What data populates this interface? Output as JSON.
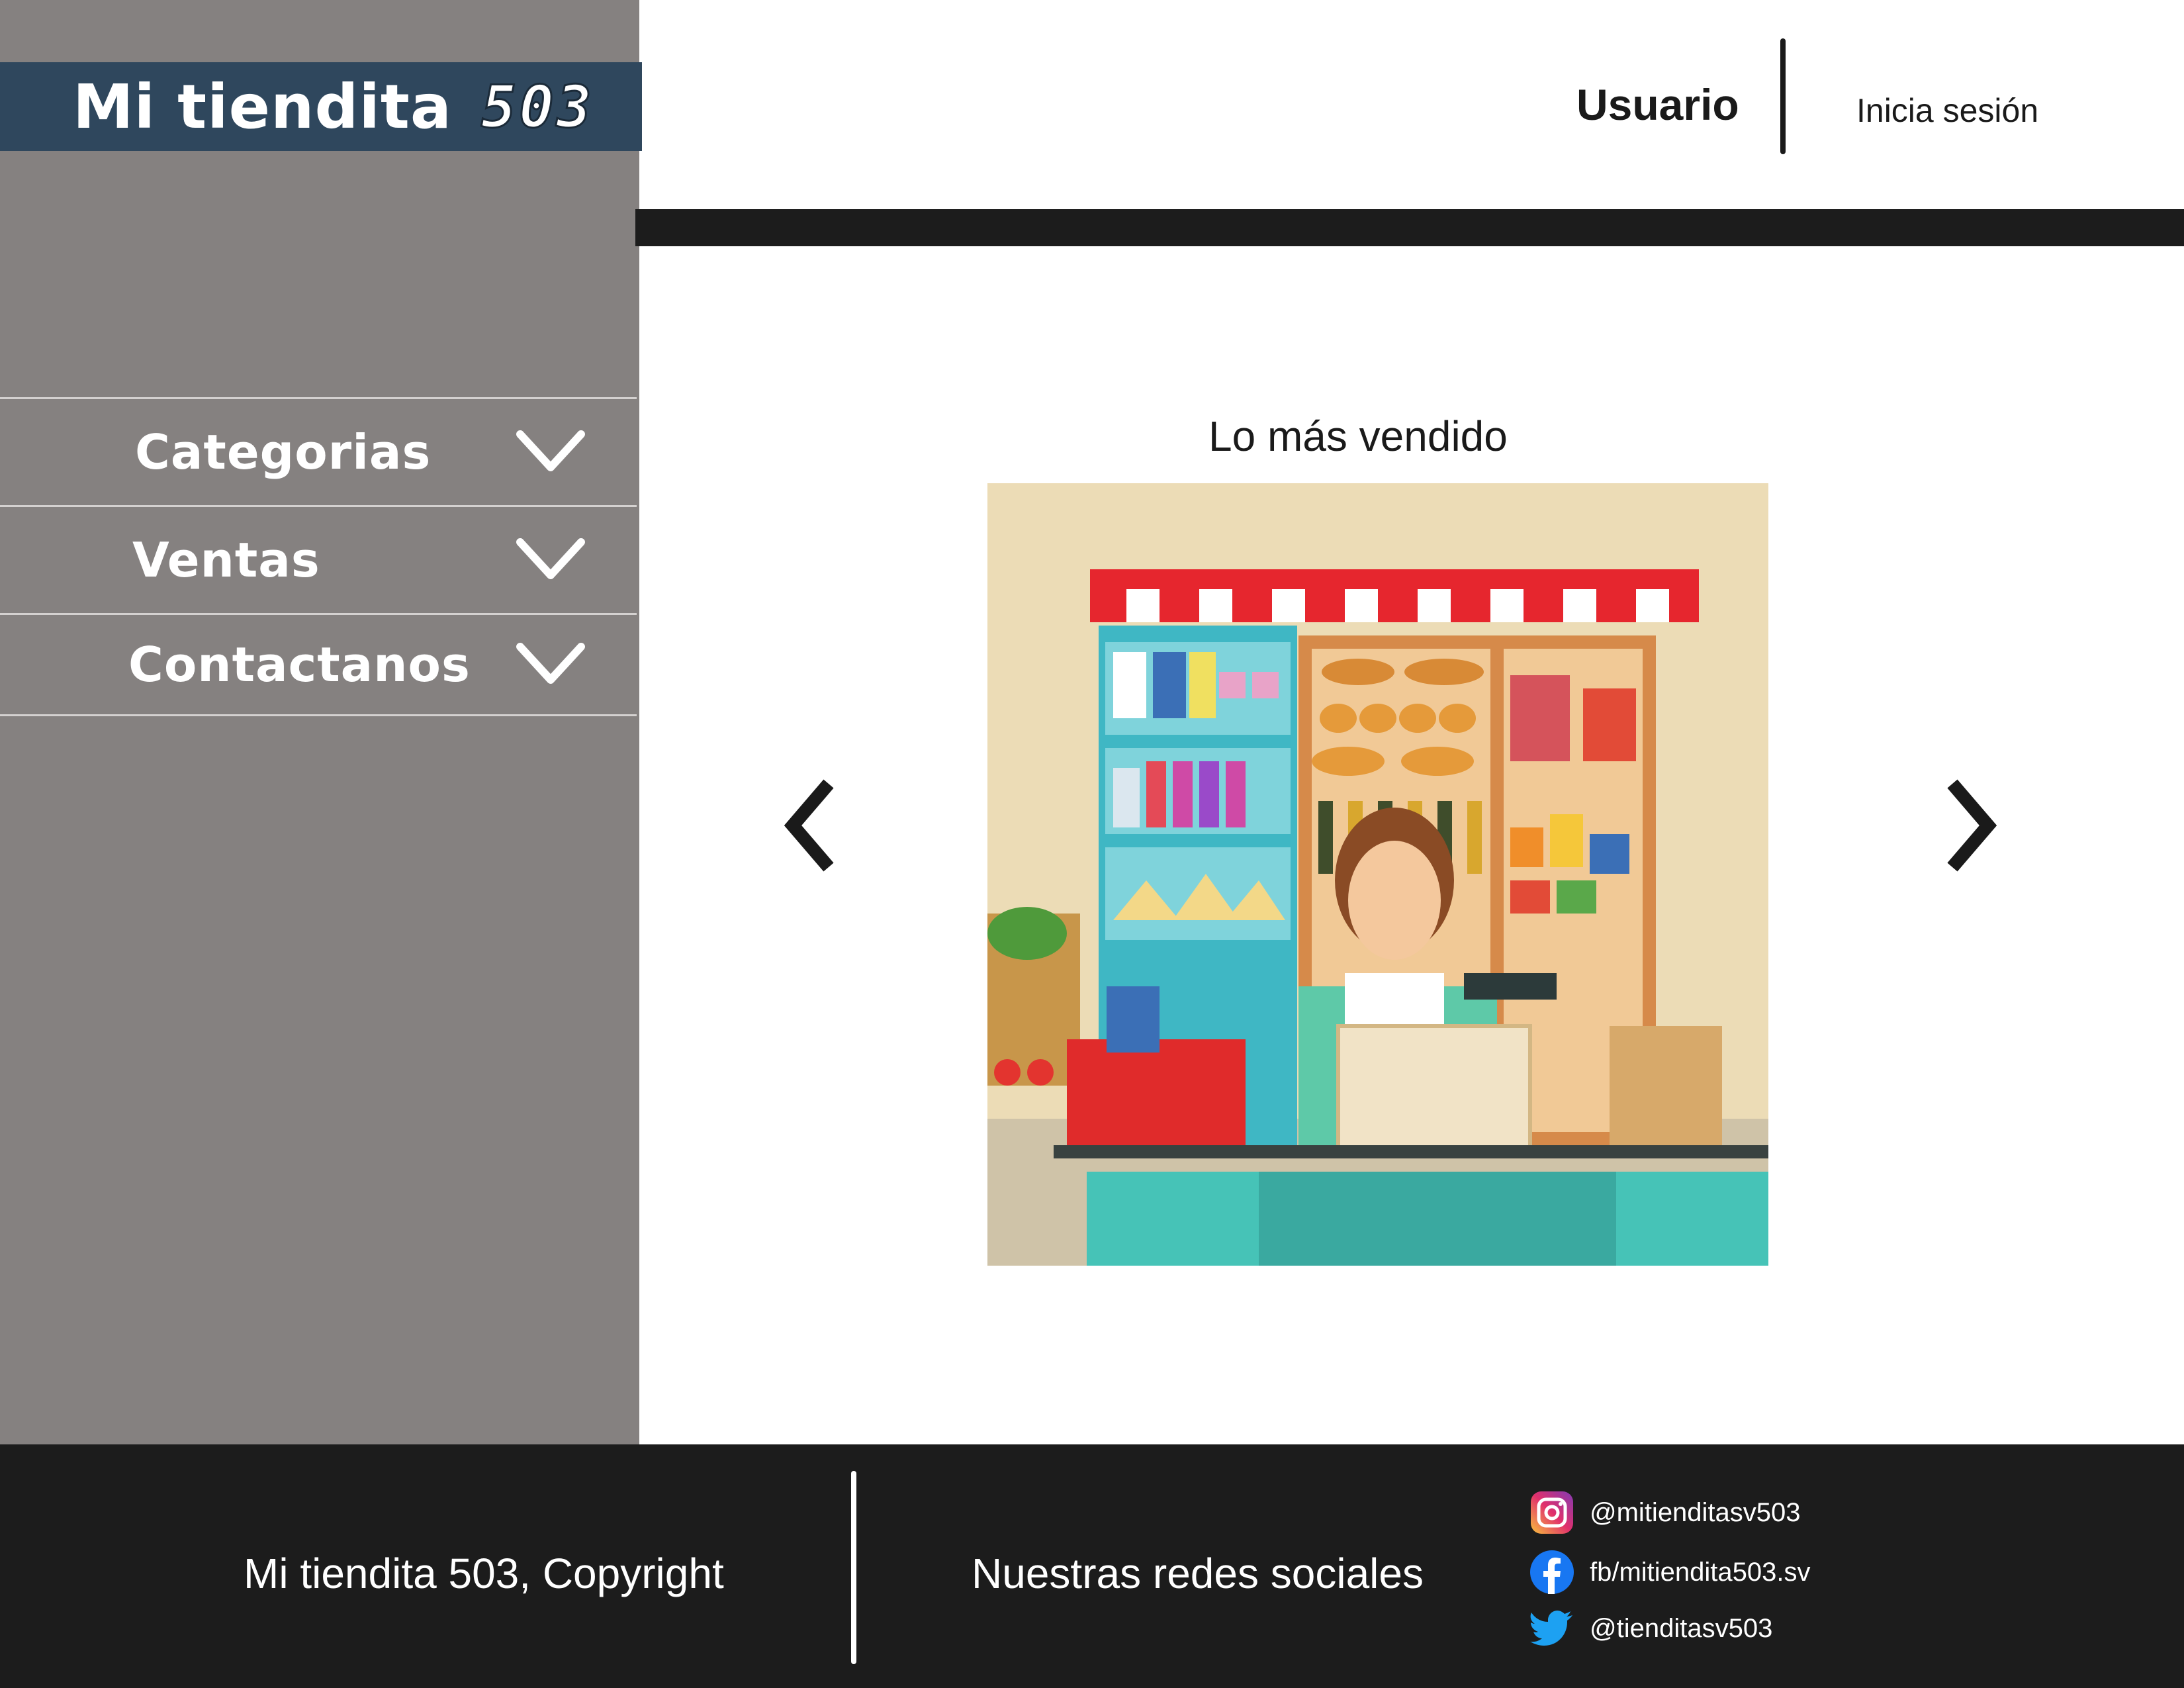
{
  "brand": {
    "name": "Mi tiendita",
    "number": "503"
  },
  "sidebar": {
    "items": [
      {
        "label": "Categorias",
        "icon": "chevron-down-icon"
      },
      {
        "label": "Ventas",
        "icon": "chevron-down-icon"
      },
      {
        "label": "Contactanos",
        "icon": "chevron-down-icon"
      }
    ]
  },
  "header": {
    "user_label": "Usuario",
    "login_label": "Inicia sesión"
  },
  "main": {
    "section_title": "Lo más vendido",
    "carousel": {
      "prev_icon": "chevron-left-icon",
      "next_icon": "chevron-right-icon",
      "image": "grocery-store-illustration"
    }
  },
  "footer": {
    "copyright": "Mi tiendita 503, Copyright",
    "social_title": "Nuestras redes sociales",
    "social": [
      {
        "network": "instagram-icon",
        "handle": "@mitienditasv503"
      },
      {
        "network": "facebook-icon",
        "handle": "fb/mitiendita503.sv"
      },
      {
        "network": "twitter-icon",
        "handle": "@tienditasv503"
      }
    ]
  },
  "colors": {
    "sidebar": "#858180",
    "brand_bar": "#2f475d",
    "dark_bar": "#1c1c1c",
    "background": "#ffffff"
  }
}
